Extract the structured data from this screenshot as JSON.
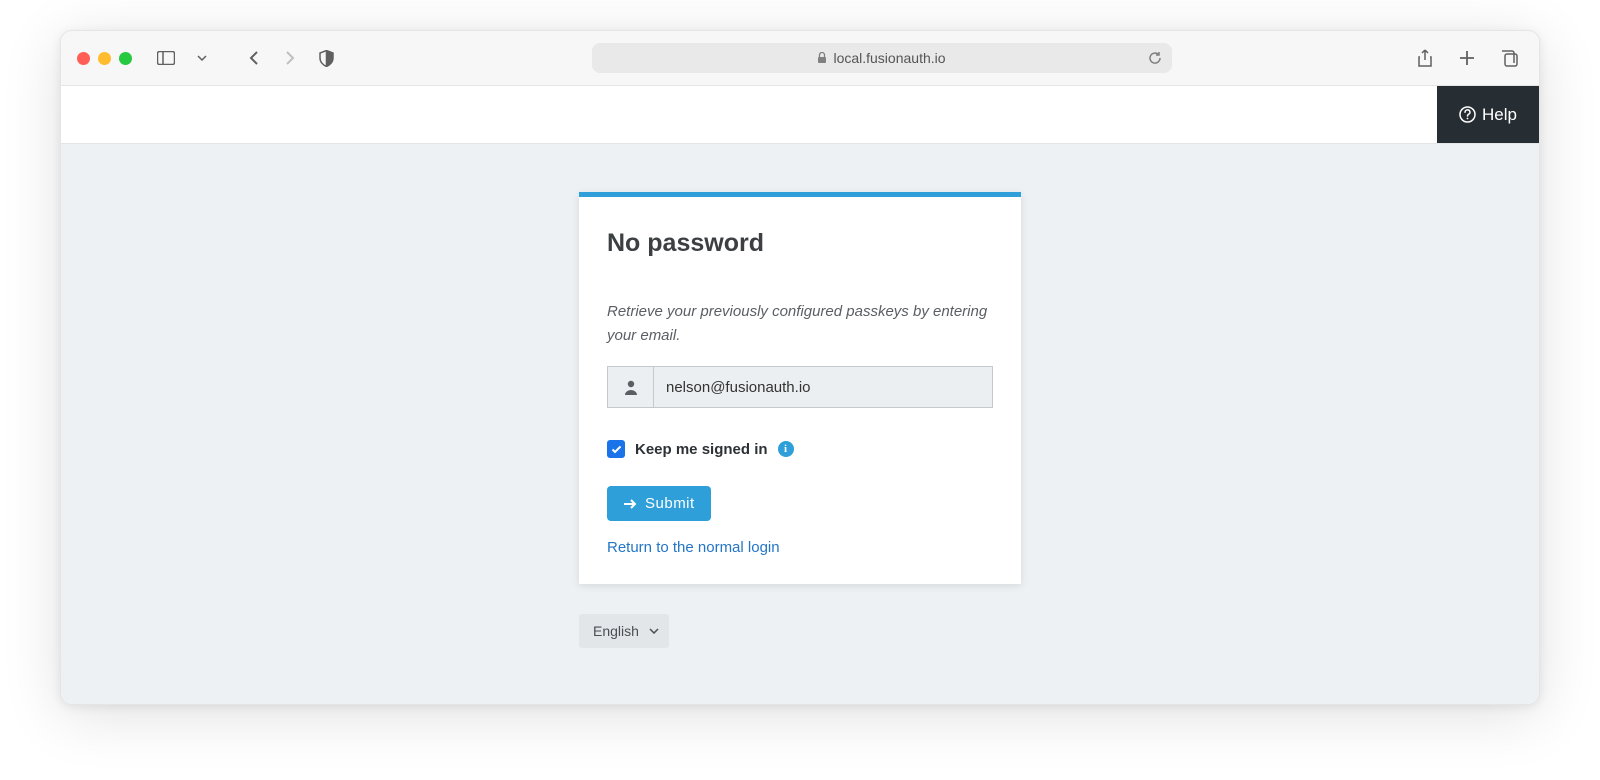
{
  "browser": {
    "url_display": "local.fusionauth.io"
  },
  "header": {
    "help_label": "Help"
  },
  "panel": {
    "title": "No password",
    "instruction": "Retrieve your previously configured passkeys by entering your email.",
    "email_value": "nelson@fusionauth.io",
    "keep_signed_in_label": "Keep me signed in",
    "keep_signed_in_checked": true,
    "submit_label": "Submit",
    "return_link_label": "Return to the normal login"
  },
  "footer": {
    "language_selected": "English"
  }
}
